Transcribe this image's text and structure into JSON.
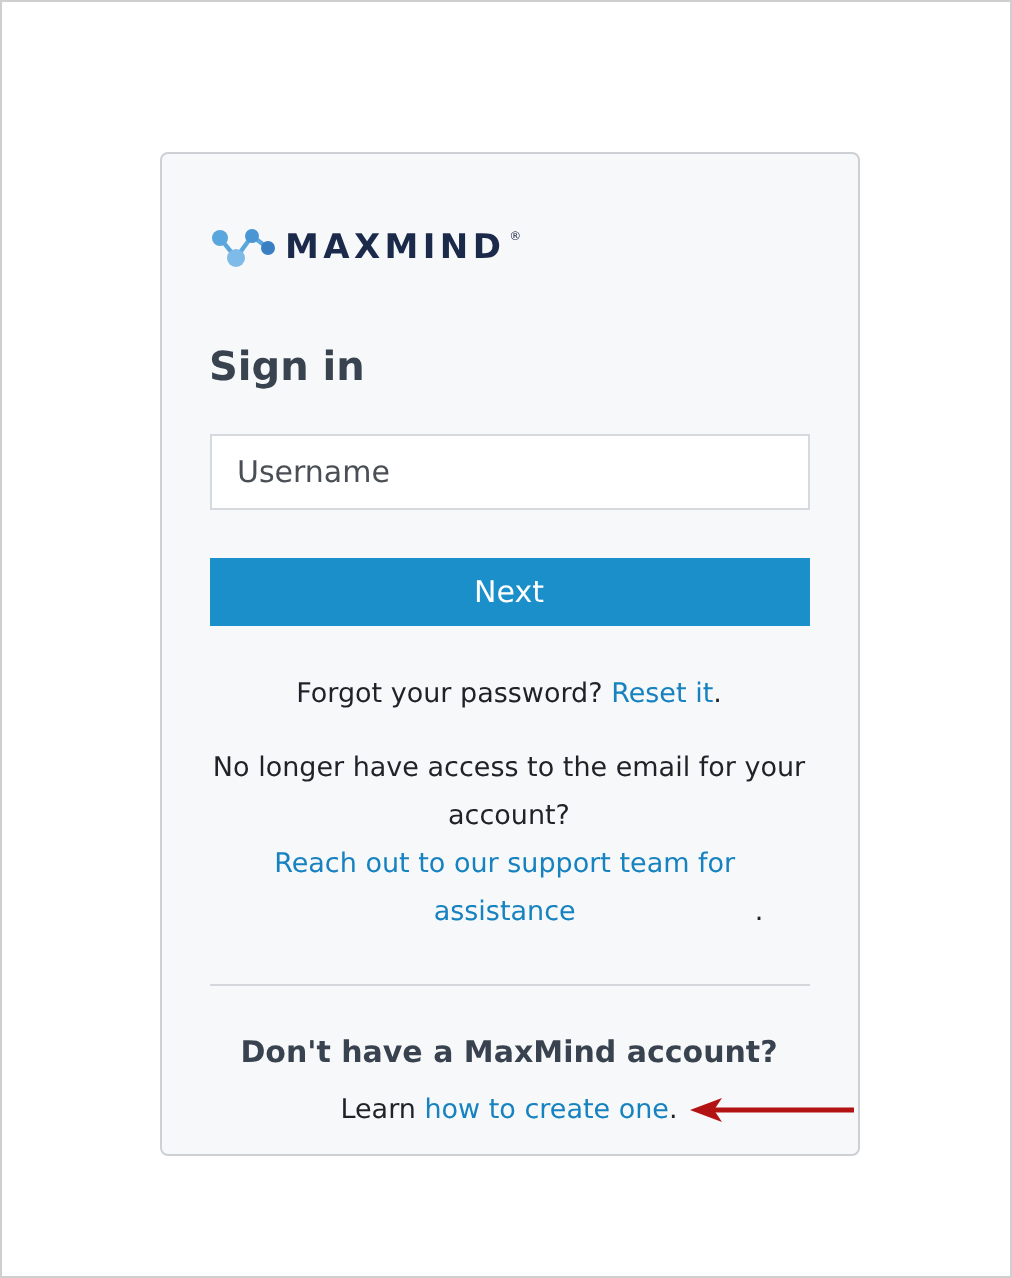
{
  "logo": {
    "text": "MAXMIND",
    "mark": "®"
  },
  "title": "Sign in",
  "username": {
    "placeholder": "Username"
  },
  "next_button": "Next",
  "forgot": {
    "text": "Forgot your password? ",
    "link": "Reset it",
    "after": "."
  },
  "no_access": {
    "text": "No longer have access to the email for your account? ",
    "link": "Reach out to our support team for assistance",
    "after": "."
  },
  "signup": {
    "heading": "Don't have a MaxMind account?",
    "text": "Learn ",
    "link": "how to create one",
    "after": ".",
    "annotation_arrow": true
  }
}
